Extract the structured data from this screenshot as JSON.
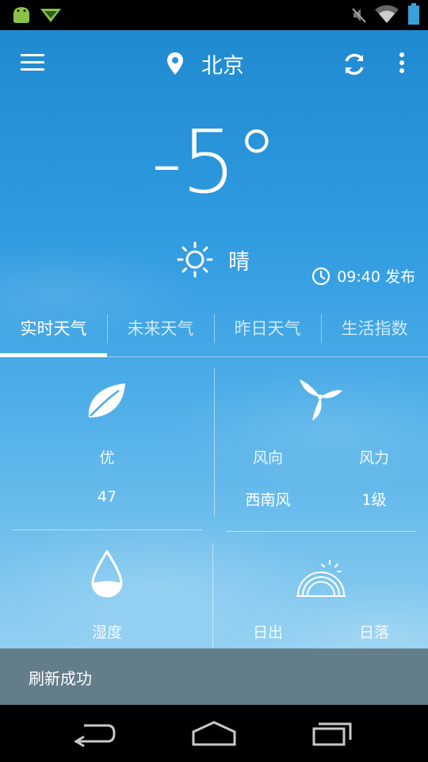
{
  "app": {
    "city": "北京",
    "temperature": "-5°",
    "condition": "晴",
    "publish_time": "09:40 发布"
  },
  "tabs": [
    {
      "label": "实时天气",
      "active": true
    },
    {
      "label": "未来天气",
      "active": false
    },
    {
      "label": "昨日天气",
      "active": false
    },
    {
      "label": "生活指数",
      "active": false
    }
  ],
  "details": {
    "air_quality": {
      "label": "优",
      "value": "47"
    },
    "wind": {
      "direction_label": "风向",
      "direction_value": "西南风",
      "force_label": "风力",
      "force_value": "1级"
    },
    "humidity": {
      "label": "湿度"
    },
    "sun": {
      "sunrise_label": "日出",
      "sunset_label": "日落"
    }
  },
  "toast": {
    "text": "刷新成功"
  },
  "colors": {
    "sky_top": "#1f8ad0",
    "sky_bottom": "#a5d8f3",
    "toast_bg": "#637d8a",
    "android_green": "#8bc34a",
    "battery": "#3aa0d8"
  },
  "icons": {
    "menu": "menu-icon",
    "location": "location-pin-icon",
    "refresh": "refresh-icon",
    "more": "more-vert-icon",
    "sun": "sun-icon",
    "clock": "clock-icon",
    "leaf": "leaf-icon",
    "fan": "wind-fan-icon",
    "drop": "water-drop-icon",
    "sunrise": "sunrise-icon"
  }
}
